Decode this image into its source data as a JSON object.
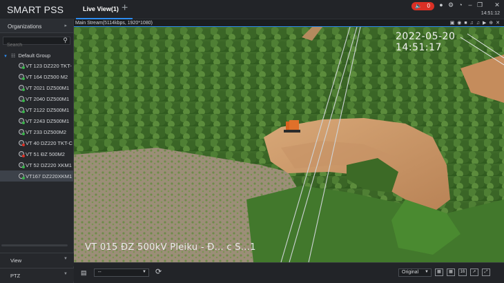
{
  "app": {
    "brand": "SMART PSS",
    "tab_label": "Live View(1)",
    "add_tab": "+",
    "alarm_count": "0",
    "clock": "14:51:12",
    "colors": {
      "accent": "#2d8cf0",
      "alarm": "#d93025",
      "online": "#39b54a"
    }
  },
  "sidebar": {
    "organizations": "Organizations",
    "search_placeholder": "Search",
    "group": "Default Group",
    "devices": [
      {
        "label": "VT 123 DZ220 TKT-",
        "status": "online"
      },
      {
        "label": "VT 164 DZ500 M2",
        "status": "online"
      },
      {
        "label": "VT 2021 DZ500M1",
        "status": "online"
      },
      {
        "label": "VT 2040 DZ500M1",
        "status": "online"
      },
      {
        "label": "VT 2122 DZ500M1",
        "status": "online"
      },
      {
        "label": "VT 2243 DZ500M1",
        "status": "online"
      },
      {
        "label": "VT 233 DZ500M2",
        "status": "online"
      },
      {
        "label": "VT 40 DZ220 TKT-C",
        "status": "offline"
      },
      {
        "label": "VT 51 ĐZ 500M2",
        "status": "offline"
      },
      {
        "label": "VT 52 DZ220 XKM1",
        "status": "online"
      },
      {
        "label": "VT167 DZ220XKM1",
        "status": "online",
        "selected": true
      }
    ],
    "view": "View",
    "ptz": "PTZ"
  },
  "video": {
    "stream_info": "Main Stream(5114kbps, 1920*1080)",
    "osd_time": "2022-05-20 14:51:17",
    "osd_name": "VT 015 ĐZ 500kV Pleiku - Đ... c S...1"
  },
  "bottombar": {
    "preset": "--",
    "scale": "Original",
    "layout_16": "16"
  }
}
